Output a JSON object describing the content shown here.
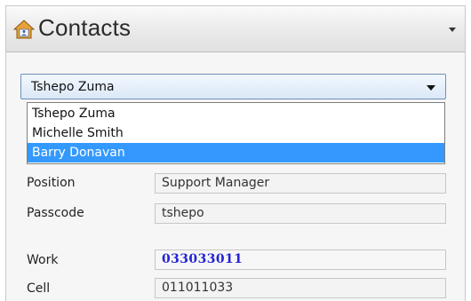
{
  "header": {
    "title": "Contacts",
    "icon": "contacts-home-icon"
  },
  "contact_select": {
    "selected": "Tshepo Zuma",
    "options": [
      {
        "label": "Tshepo Zuma",
        "highlighted": false
      },
      {
        "label": "Michelle Smith",
        "highlighted": false
      },
      {
        "label": "Barry Donavan",
        "highlighted": true
      }
    ]
  },
  "fields": {
    "position": {
      "label": "Position",
      "value": "Support Manager"
    },
    "passcode": {
      "label": "Passcode",
      "value": "tshepo"
    },
    "work": {
      "label": "Work",
      "value": "033033011"
    },
    "cell": {
      "label": "Cell",
      "value": "011011033"
    }
  },
  "colors": {
    "highlight": "#3399ff",
    "work_number": "#2323d6"
  }
}
